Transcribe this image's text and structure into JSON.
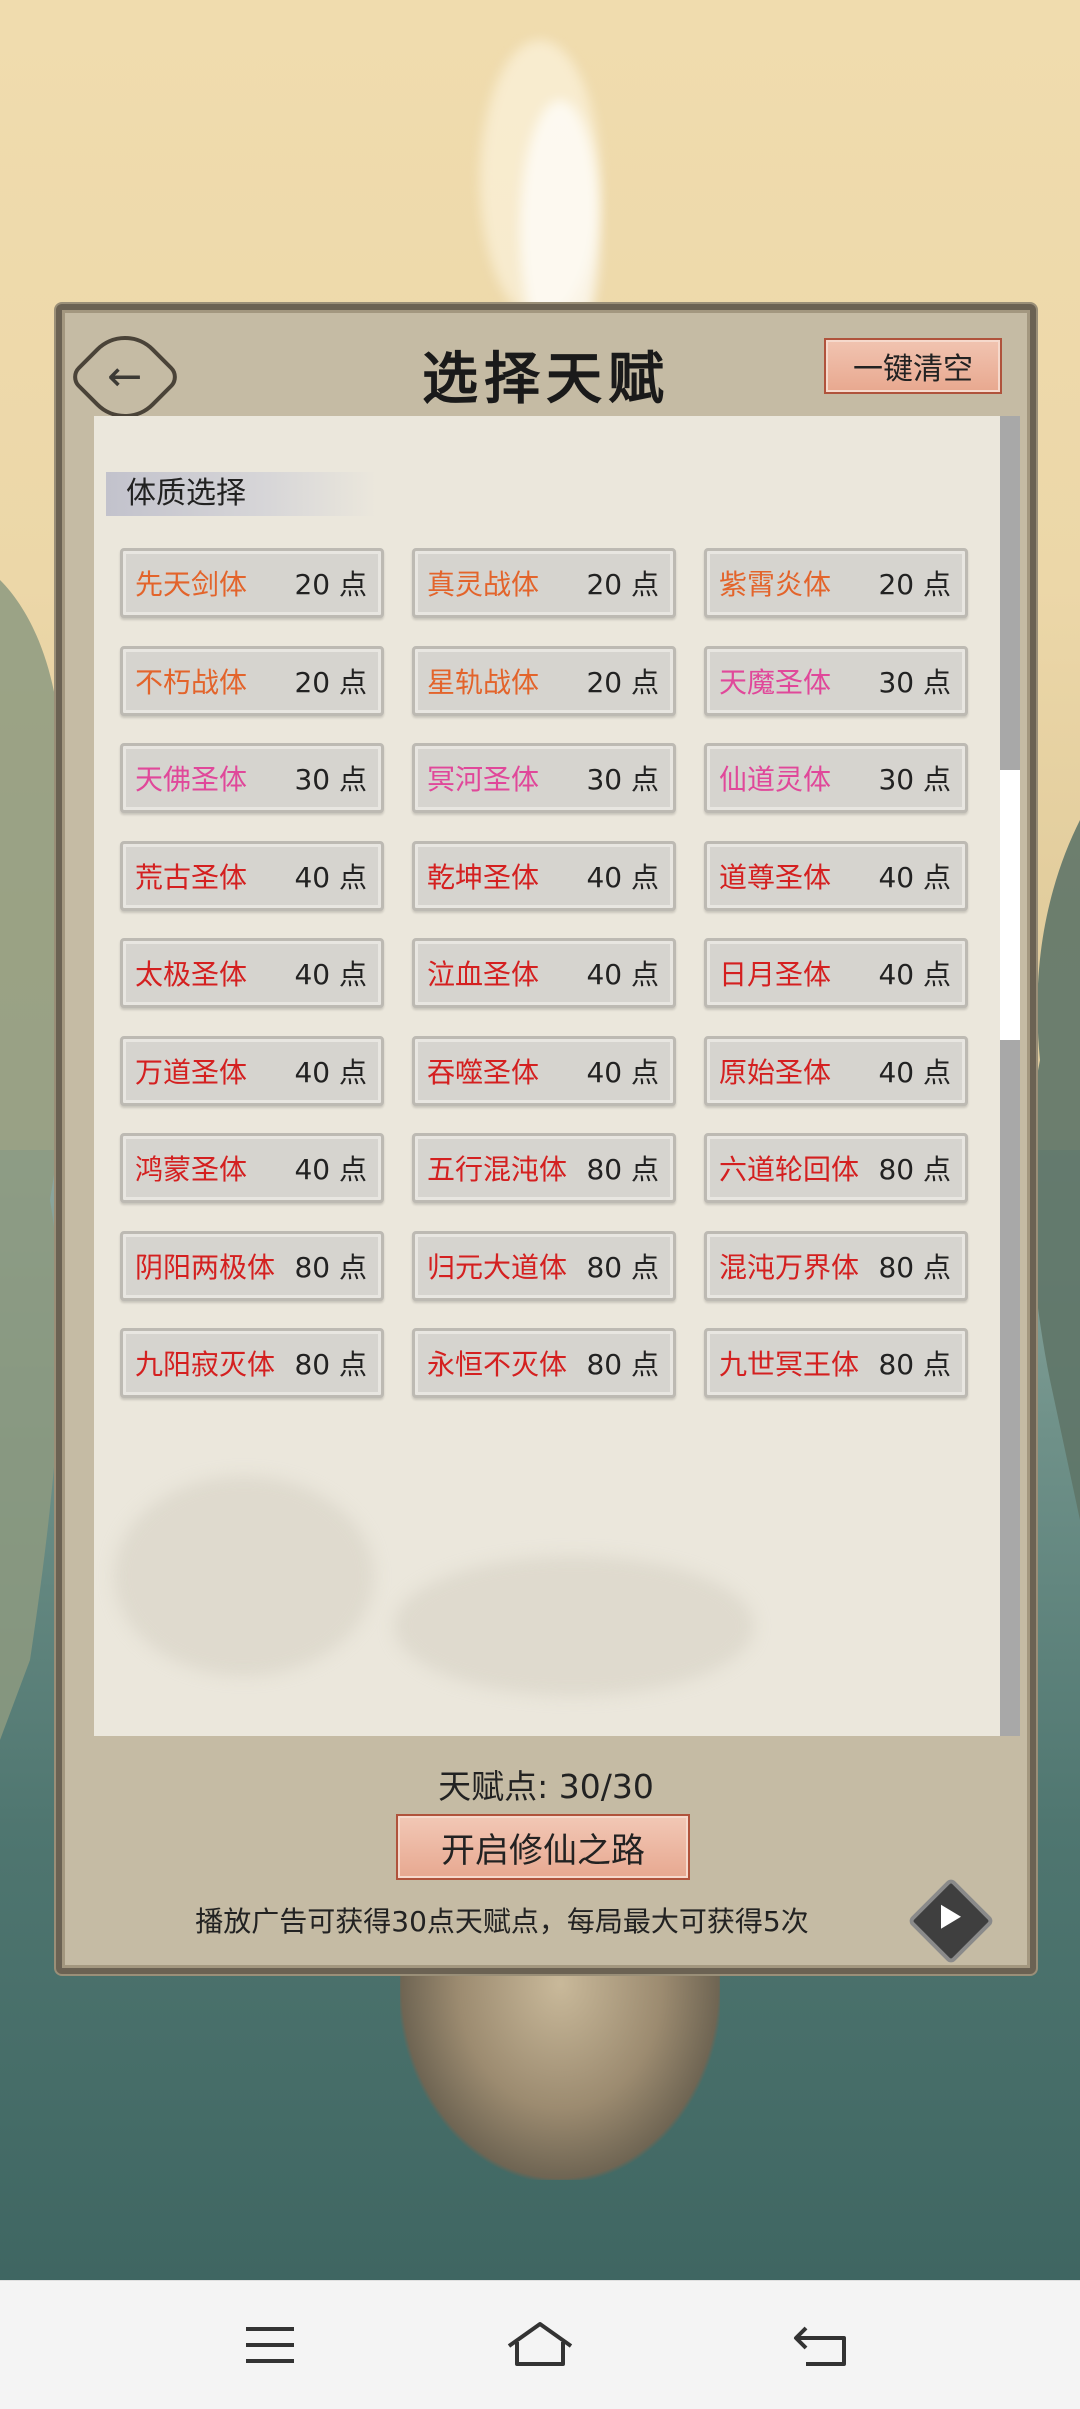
{
  "title": "选择天赋",
  "clear_label": "一键清空",
  "section_label": "体质选择",
  "colors": {
    "orange": "#e3642b",
    "pink": "#e0489a",
    "red": "#d42020"
  },
  "talents": [
    {
      "name": "先天剑体",
      "points": "20 点",
      "color": "#e3642b"
    },
    {
      "name": "真灵战体",
      "points": "20 点",
      "color": "#e3642b"
    },
    {
      "name": "紫霄炎体",
      "points": "20 点",
      "color": "#e3642b"
    },
    {
      "name": "不朽战体",
      "points": "20 点",
      "color": "#e3642b"
    },
    {
      "name": "星轨战体",
      "points": "20 点",
      "color": "#e3642b"
    },
    {
      "name": "天魔圣体",
      "points": "30 点",
      "color": "#e0489a"
    },
    {
      "name": "天佛圣体",
      "points": "30 点",
      "color": "#e0489a"
    },
    {
      "name": "冥河圣体",
      "points": "30 点",
      "color": "#e0489a"
    },
    {
      "name": "仙道灵体",
      "points": "30 点",
      "color": "#e0489a"
    },
    {
      "name": "荒古圣体",
      "points": "40 点",
      "color": "#d42020"
    },
    {
      "name": "乾坤圣体",
      "points": "40 点",
      "color": "#d42020"
    },
    {
      "name": "道尊圣体",
      "points": "40 点",
      "color": "#d42020"
    },
    {
      "name": "太极圣体",
      "points": "40 点",
      "color": "#d42020"
    },
    {
      "name": "泣血圣体",
      "points": "40 点",
      "color": "#d42020"
    },
    {
      "name": "日月圣体",
      "points": "40 点",
      "color": "#d42020"
    },
    {
      "name": "万道圣体",
      "points": "40 点",
      "color": "#d42020"
    },
    {
      "name": "吞噬圣体",
      "points": "40 点",
      "color": "#d42020"
    },
    {
      "name": "原始圣体",
      "points": "40 点",
      "color": "#d42020"
    },
    {
      "name": "鸿蒙圣体",
      "points": "40 点",
      "color": "#d42020"
    },
    {
      "name": "五行混沌体",
      "points": "80 点",
      "color": "#d42020"
    },
    {
      "name": "六道轮回体",
      "points": "80 点",
      "color": "#d42020"
    },
    {
      "name": "阴阳两极体",
      "points": "80 点",
      "color": "#d42020"
    },
    {
      "name": "归元大道体",
      "points": "80 点",
      "color": "#d42020"
    },
    {
      "name": "混沌万界体",
      "points": "80 点",
      "color": "#d42020"
    },
    {
      "name": "九阳寂灭体",
      "points": "80 点",
      "color": "#d42020"
    },
    {
      "name": "永恒不灭体",
      "points": "80 点",
      "color": "#d42020"
    },
    {
      "name": "九世冥王体",
      "points": "80 点",
      "color": "#d42020"
    }
  ],
  "points_display": "天赋点:  30/30",
  "start_label": "开启修仙之路",
  "ad_note": "播放广告可获得30点天赋点，每局最大可获得5次",
  "icons": {
    "back": "back-arrow-icon",
    "play": "play-icon",
    "menu": "menu-icon",
    "home": "home-icon",
    "return": "return-icon"
  }
}
